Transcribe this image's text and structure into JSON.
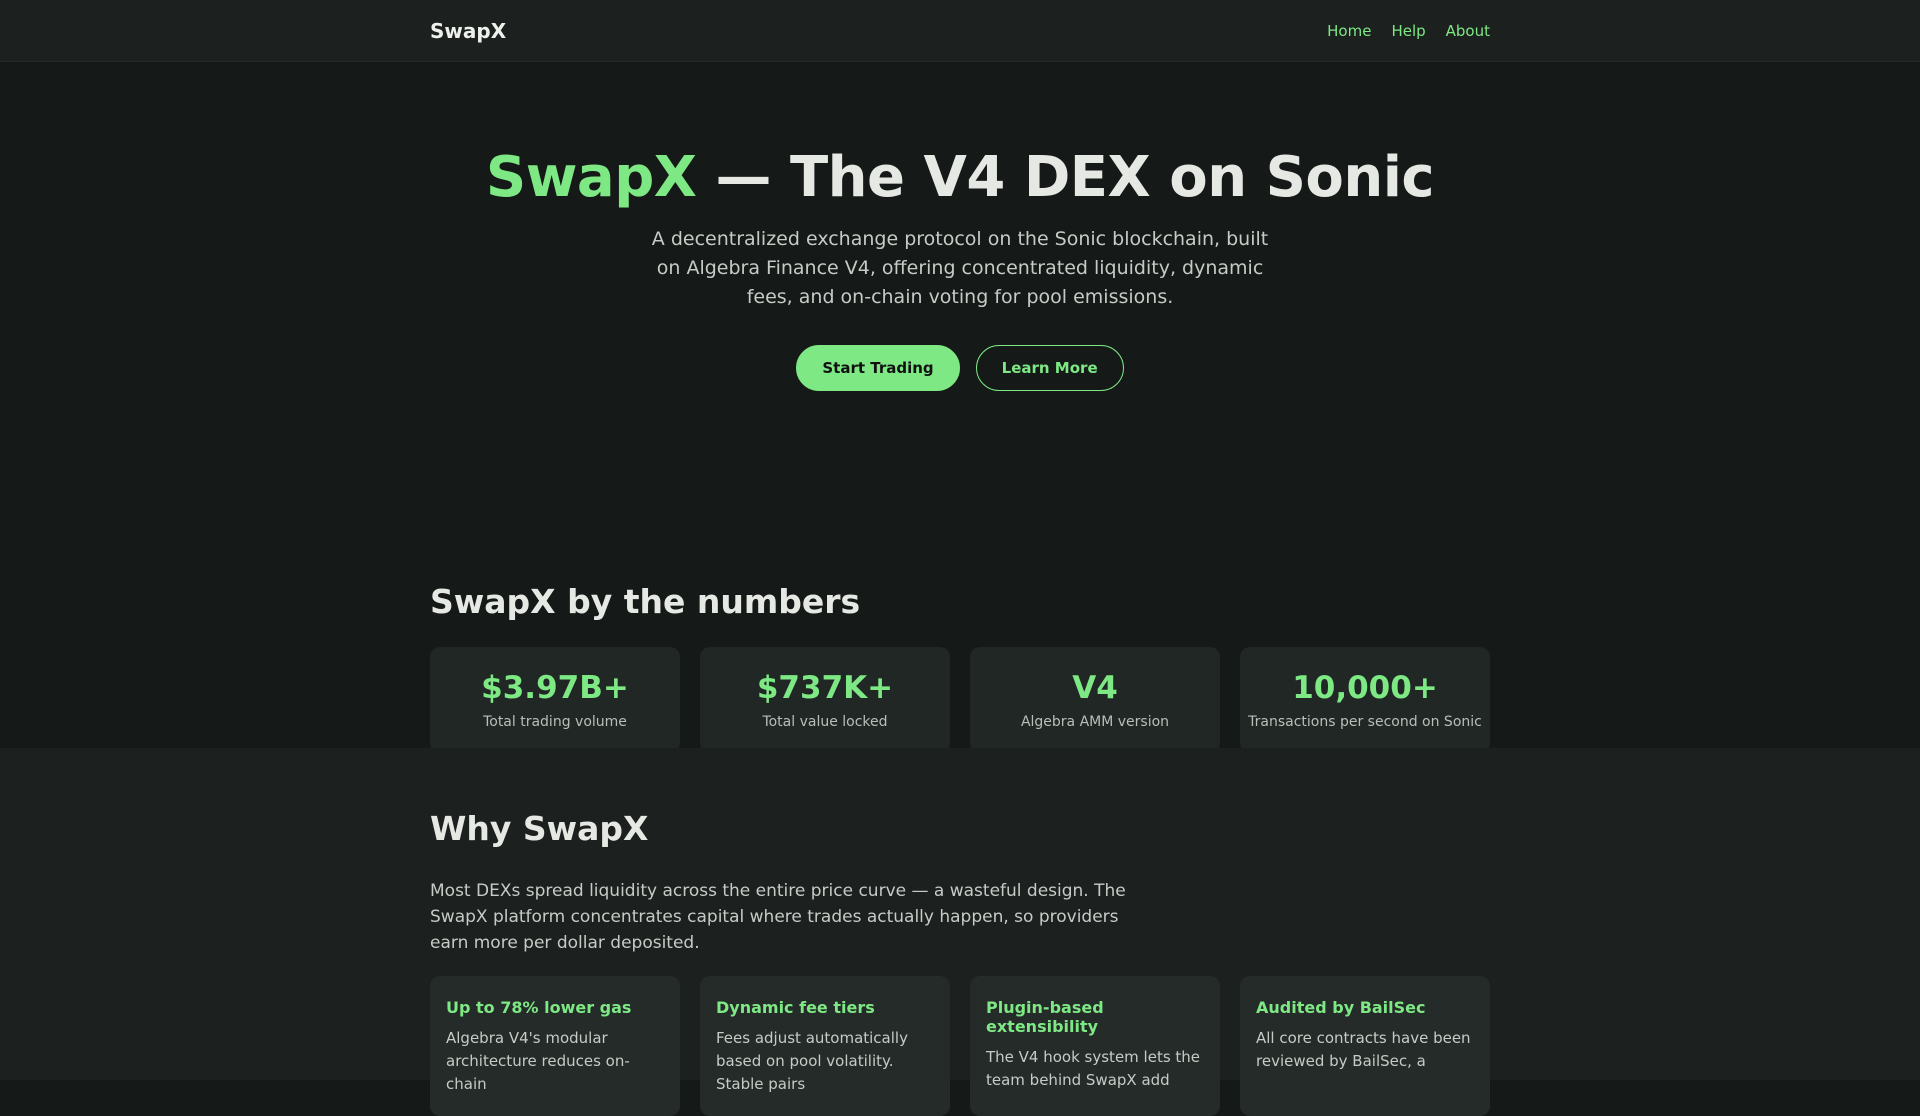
{
  "nav": {
    "brand": "SwapX",
    "links": [
      "Home",
      "Help",
      "About"
    ]
  },
  "hero": {
    "title_accent": "SwapX",
    "title_rest": " — The V4 DEX on Sonic",
    "subtitle": "A decentralized exchange protocol on the Sonic blockchain, built on Algebra Finance V4, offering concentrated liquidity, dynamic fees, and on-chain voting for pool emissions.",
    "primary_cta": "Start Trading",
    "secondary_cta": "Learn More"
  },
  "numbers": {
    "heading": "SwapX by the numbers",
    "stats": [
      {
        "value": "$3.97B+",
        "label": "Total trading volume"
      },
      {
        "value": "$737K+",
        "label": "Total value locked"
      },
      {
        "value": "V4",
        "label": "Algebra AMM version"
      },
      {
        "value": "10,000+",
        "label": "Transactions per second on Sonic"
      }
    ]
  },
  "why": {
    "heading": "Why SwapX",
    "intro": "Most DEXs spread liquidity across the entire price curve — a wasteful design. The SwapX platform concentrates capital where trades actually happen, so providers earn more per dollar deposited.",
    "features": [
      {
        "title": "Up to 78% lower gas",
        "body": "Algebra V4's modular architecture reduces on-chain"
      },
      {
        "title": "Dynamic fee tiers",
        "body": "Fees adjust automatically based on pool volatility. Stable pairs"
      },
      {
        "title": "Plugin-based extensibility",
        "body": "The V4 hook system lets the team behind SwapX add"
      },
      {
        "title": "Audited by BailSec",
        "body": "All core contracts have been reviewed by BailSec, a"
      }
    ]
  },
  "colors": {
    "accent": "#7de884",
    "background": "#151917",
    "card": "#212725"
  }
}
